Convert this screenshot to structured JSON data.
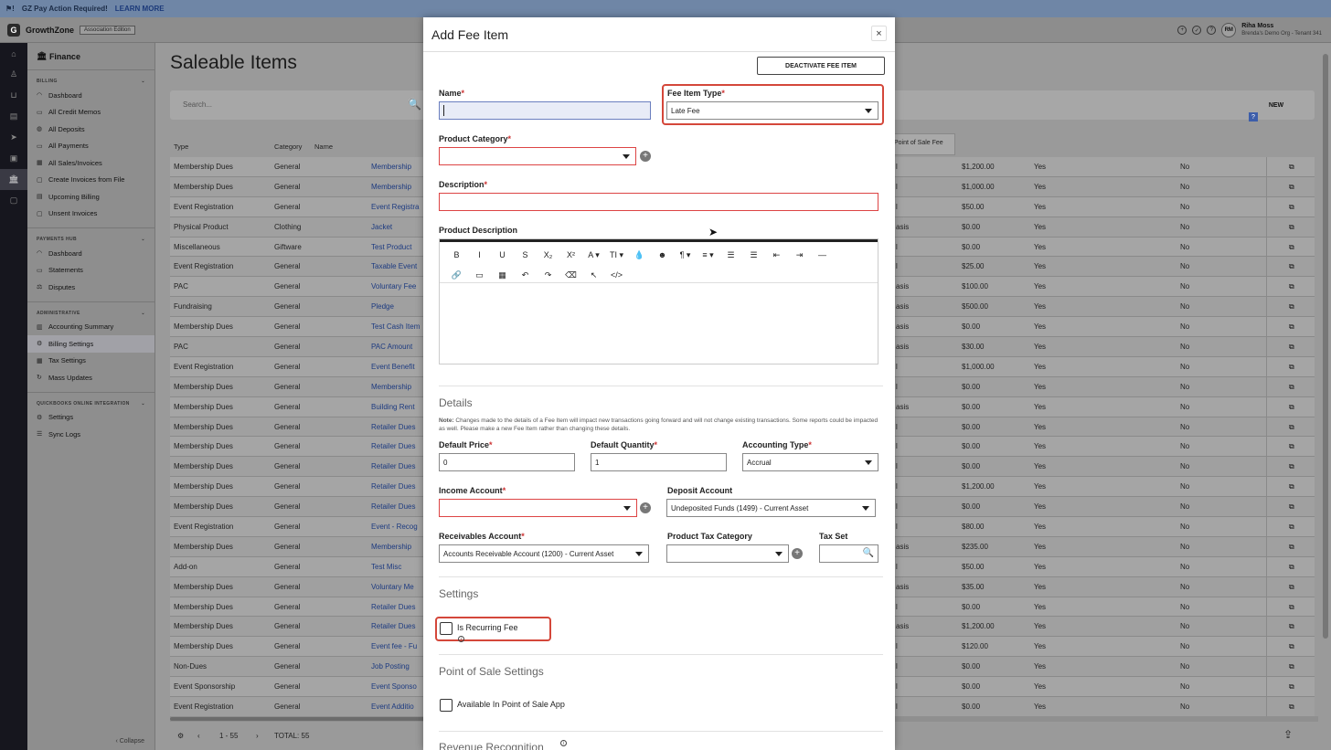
{
  "banner": {
    "text": "GZ Pay Action Required!",
    "link": "LEARN MORE"
  },
  "topbar": {
    "brand": "GrowthZone",
    "edition": "Association Edition",
    "user_initials": "RM",
    "user_name": "Riha Moss",
    "user_org": "Brenda's Demo Org - Tenant 341"
  },
  "sidebar": {
    "title": "Finance",
    "sections": [
      {
        "heading": "BILLING",
        "items": [
          "Dashboard",
          "All Credit Memos",
          "All Deposits",
          "All Payments",
          "All Sales/Invoices",
          "Create Invoices from File",
          "Upcoming Billing",
          "Unsent Invoices"
        ]
      },
      {
        "heading": "PAYMENTS HUB",
        "items": [
          "Dashboard",
          "Statements",
          "Disputes"
        ]
      },
      {
        "heading": "ADMINISTRATIVE",
        "items": [
          "Accounting Summary",
          "Billing Settings",
          "Tax Settings",
          "Mass Updates"
        ]
      },
      {
        "heading": "QUICKBOOKS ONLINE INTEGRATION",
        "items": [
          "Settings",
          "Sync Logs"
        ]
      }
    ],
    "collapse": "Collapse"
  },
  "main": {
    "title": "Saleable Items",
    "search_placeholder": "Search...",
    "new_label": "NEW",
    "help": "?",
    "columns": {
      "type": "Type",
      "category": "Category",
      "name": "Name",
      "pos": "Point of Sale Fee"
    },
    "rows": [
      {
        "type": "Membership Dues",
        "cat": "General",
        "name": "Membership",
        "c1": "l",
        "price": "$1,200.00",
        "a": "Yes",
        "b": "No"
      },
      {
        "type": "Membership Dues",
        "cat": "General",
        "name": "Membership",
        "c1": "l",
        "price": "$1,000.00",
        "a": "Yes",
        "b": "No"
      },
      {
        "type": "Event Registration",
        "cat": "General",
        "name": "Event Registra",
        "c1": "l",
        "price": "$50.00",
        "a": "Yes",
        "b": "No"
      },
      {
        "type": "Physical Product",
        "cat": "Clothing",
        "name": "Jacket",
        "c1": "asis",
        "price": "$0.00",
        "a": "Yes",
        "b": "No"
      },
      {
        "type": "Miscellaneous",
        "cat": "Giftware",
        "name": "Test Product",
        "c1": "l",
        "price": "$0.00",
        "a": "Yes",
        "b": "No"
      },
      {
        "type": "Event Registration",
        "cat": "General",
        "name": "Taxable Event",
        "c1": "l",
        "price": "$25.00",
        "a": "Yes",
        "b": "No"
      },
      {
        "type": "PAC",
        "cat": "General",
        "name": "Voluntary Fee",
        "c1": "asis",
        "price": "$100.00",
        "a": "Yes",
        "b": "No"
      },
      {
        "type": "Fundraising",
        "cat": "General",
        "name": "Pledge",
        "c1": "asis",
        "price": "$500.00",
        "a": "Yes",
        "b": "No"
      },
      {
        "type": "Membership Dues",
        "cat": "General",
        "name": "Test Cash Item",
        "c1": "asis",
        "price": "$0.00",
        "a": "Yes",
        "b": "No"
      },
      {
        "type": "PAC",
        "cat": "General",
        "name": "PAC Amount",
        "c1": "asis",
        "price": "$30.00",
        "a": "Yes",
        "b": "No"
      },
      {
        "type": "Event Registration",
        "cat": "General",
        "name": "Event Benefit",
        "c1": "l",
        "price": "$1,000.00",
        "a": "Yes",
        "b": "No"
      },
      {
        "type": "Membership Dues",
        "cat": "General",
        "name": "Membership",
        "c1": "l",
        "price": "$0.00",
        "a": "Yes",
        "b": "No"
      },
      {
        "type": "Membership Dues",
        "cat": "General",
        "name": "Building Rent",
        "c1": "asis",
        "price": "$0.00",
        "a": "Yes",
        "b": "No"
      },
      {
        "type": "Membership Dues",
        "cat": "General",
        "name": "Retailer Dues",
        "c1": "l",
        "price": "$0.00",
        "a": "Yes",
        "b": "No"
      },
      {
        "type": "Membership Dues",
        "cat": "General",
        "name": "Retailer Dues",
        "c1": "l",
        "price": "$0.00",
        "a": "Yes",
        "b": "No"
      },
      {
        "type": "Membership Dues",
        "cat": "General",
        "name": "Retailer Dues",
        "c1": "l",
        "price": "$0.00",
        "a": "Yes",
        "b": "No"
      },
      {
        "type": "Membership Dues",
        "cat": "General",
        "name": "Retailer Dues",
        "c1": "l",
        "price": "$1,200.00",
        "a": "Yes",
        "b": "No"
      },
      {
        "type": "Membership Dues",
        "cat": "General",
        "name": "Retailer Dues",
        "c1": "l",
        "price": "$0.00",
        "a": "Yes",
        "b": "No"
      },
      {
        "type": "Event Registration",
        "cat": "General",
        "name": "Event - Recog",
        "c1": "l",
        "price": "$80.00",
        "a": "Yes",
        "b": "No"
      },
      {
        "type": "Membership Dues",
        "cat": "General",
        "name": "Membership",
        "c1": "asis",
        "price": "$235.00",
        "a": "Yes",
        "b": "No"
      },
      {
        "type": "Add-on",
        "cat": "General",
        "name": "Test Misc",
        "c1": "l",
        "price": "$50.00",
        "a": "Yes",
        "b": "No"
      },
      {
        "type": "Membership Dues",
        "cat": "General",
        "name": "Voluntary Me",
        "c1": "asis",
        "price": "$35.00",
        "a": "Yes",
        "b": "No"
      },
      {
        "type": "Membership Dues",
        "cat": "General",
        "name": "Retailer Dues",
        "c1": "l",
        "price": "$0.00",
        "a": "Yes",
        "b": "No"
      },
      {
        "type": "Membership Dues",
        "cat": "General",
        "name": "Retailer Dues",
        "c1": "asis",
        "price": "$1,200.00",
        "a": "Yes",
        "b": "No"
      },
      {
        "type": "Membership Dues",
        "cat": "General",
        "name": "Event fee - Fu",
        "c1": "l",
        "price": "$120.00",
        "a": "Yes",
        "b": "No"
      },
      {
        "type": "Non-Dues",
        "cat": "General",
        "name": "Job Posting",
        "c1": "l",
        "price": "$0.00",
        "a": "Yes",
        "b": "No"
      },
      {
        "type": "Event Sponsorship",
        "cat": "General",
        "name": "Event Sponso",
        "c1": "l",
        "price": "$0.00",
        "a": "Yes",
        "b": "No"
      },
      {
        "type": "Event Registration",
        "cat": "General",
        "name": "Event Additio",
        "c1": "l",
        "price": "$0.00",
        "a": "Yes",
        "b": "No"
      }
    ],
    "pagination": {
      "range": "1 - 55",
      "total": "TOTAL: 55"
    }
  },
  "modal": {
    "title": "Add Fee Item",
    "deactivate": "DEACTIVATE FEE ITEM",
    "name_label": "Name",
    "name_value": "",
    "fee_type_label": "Fee Item Type",
    "fee_type_value": "Late Fee",
    "product_category_label": "Product Category",
    "description_label": "Description",
    "product_description_label": "Product Description",
    "toolbar_row1": [
      "B",
      "I",
      "U",
      "S",
      "X₂",
      "X²",
      "A ▾",
      "TI ▾",
      "💧",
      "☻",
      "¶ ▾",
      "≡ ▾",
      "☰",
      "☰",
      "⇤",
      "⇥",
      "—"
    ],
    "toolbar_row2": [
      "🔗",
      "▭",
      "▦",
      "↶",
      "↷",
      "⌫",
      "↖",
      "</>"
    ],
    "details_heading": "Details",
    "note_bold": "Note:",
    "note": "Changes made to the details of a Fee Item will impact new transactions going forward and will not change existing transactions. Some reports could be impacted as well. Please make a new Fee Item rather than changing these details.",
    "default_price_label": "Default Price",
    "default_price_value": "0",
    "default_qty_label": "Default Quantity",
    "default_qty_value": "1",
    "accounting_type_label": "Accounting Type",
    "accounting_type_value": "Accrual",
    "income_account_label": "Income Account",
    "deposit_account_label": "Deposit Account",
    "deposit_account_value": "Undeposited Funds (1499) - Current Asset",
    "receivables_label": "Receivables Account",
    "receivables_value": "Accounts Receivable Account (1200) - Current Asset",
    "product_tax_label": "Product Tax Category",
    "tax_set_label": "Tax Set",
    "settings_heading": "Settings",
    "recurring_label": "Is Recurring Fee",
    "pos_heading": "Point of Sale Settings",
    "pos_app_label": "Available In Point of Sale App",
    "revenue_heading": "Revenue Recognition"
  }
}
